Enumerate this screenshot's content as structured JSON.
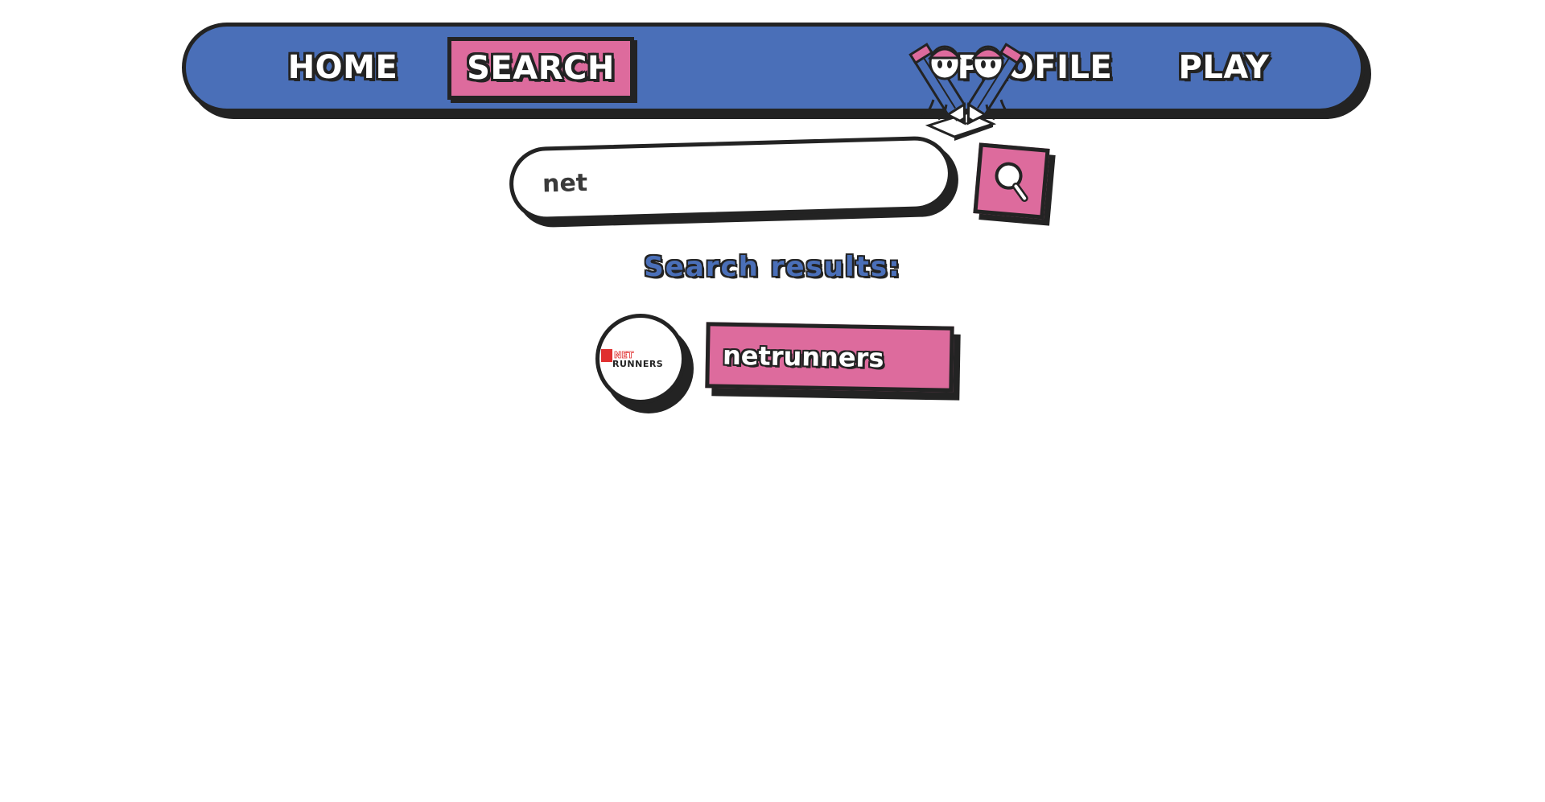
{
  "nav": {
    "items": [
      {
        "label": "HOME"
      },
      {
        "label": "SEARCH"
      },
      {
        "label": "PROFILE"
      },
      {
        "label": "PLAY"
      }
    ],
    "active": "SEARCH"
  },
  "search": {
    "query": "net"
  },
  "results": {
    "title": "Search results:",
    "items": [
      {
        "name": "netrunners",
        "logo_text_top": "NET",
        "logo_text_bottom": "RUNNERS"
      }
    ]
  },
  "colors": {
    "nav_blue": "#4a6fb8",
    "accent_pink": "#dd6b9d",
    "outline": "#232323",
    "logo_red": "#e03030"
  },
  "icons": {
    "logo": "two-pencil-characters-logo",
    "search_button": "magnifier-icon"
  }
}
